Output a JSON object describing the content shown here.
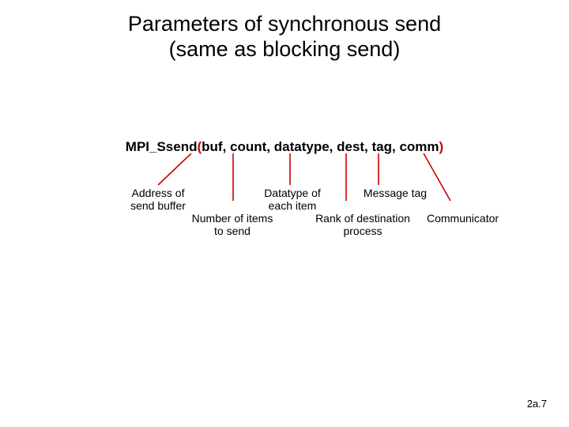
{
  "title_line1": "Parameters of synchronous send",
  "title_line2": "(same as blocking send)",
  "signature": {
    "fn": "MPI_Ssend",
    "open": "(",
    "args": "buf, count, datatype, dest, tag, comm",
    "close": ")"
  },
  "labels": {
    "buf": {
      "line1": "Address of",
      "line2": "send buffer"
    },
    "count": {
      "line1": "Number of items",
      "line2": "to send"
    },
    "datatype": {
      "line1": "Datatype of",
      "line2": "each item"
    },
    "dest": {
      "line1": "Rank of destination",
      "line2": "process"
    },
    "tag": "Message tag",
    "comm": "Communicator"
  },
  "page": "2a.7"
}
